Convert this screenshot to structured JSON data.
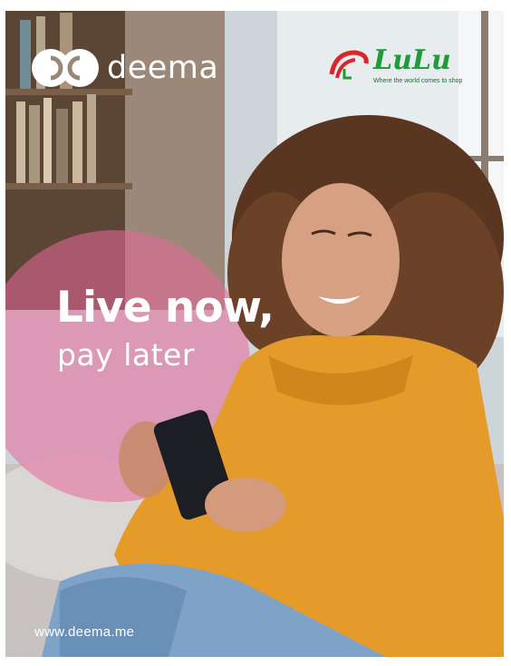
{
  "brand": {
    "name": "deema",
    "logo_icon": "deema-logo-icon"
  },
  "partner": {
    "name": "LuLu",
    "tagline": "Where the world comes to shop",
    "logo_icon": "lulu-logo-icon"
  },
  "headline": {
    "line1": "Live now,",
    "line2": "pay later"
  },
  "footer": {
    "url": "www.deema.me"
  },
  "colors": {
    "pink_overlay": "#e9679b",
    "sweater": "#e49b2a",
    "lulu_red": "#d9262c",
    "lulu_green": "#1f9c3a"
  }
}
